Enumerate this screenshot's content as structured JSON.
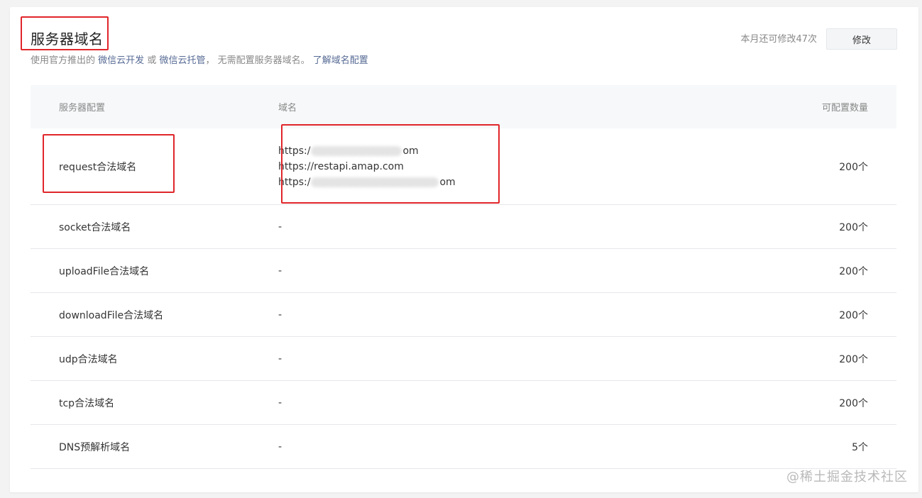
{
  "page": {
    "title": "服务器域名",
    "subtitle_prefix": "使用官方推出的",
    "link_cloud_dev": "微信云开发",
    "subtitle_or": "或",
    "link_cloud_host": "微信云托管",
    "subtitle_mid": "，  无需配置服务器域名。",
    "link_learn": "了解域名配置",
    "quota_text": "本月还可修改47次",
    "modify_label": "修改",
    "watermark": "@稀土掘金技术社区"
  },
  "table": {
    "headers": [
      "服务器配置",
      "域名",
      "可配置数量"
    ],
    "rows": [
      {
        "name": "request合法域名",
        "domains": [
          "https:/",
          "https://restapi.amap.com",
          "https:/"
        ],
        "domain_tails": [
          "om",
          "",
          "om"
        ],
        "count": "200个"
      },
      {
        "name": "socket合法域名",
        "domain": "-",
        "count": "200个"
      },
      {
        "name": "uploadFile合法域名",
        "domain": "-",
        "count": "200个"
      },
      {
        "name": "downloadFile合法域名",
        "domain": "-",
        "count": "200个"
      },
      {
        "name": "udp合法域名",
        "domain": "-",
        "count": "200个"
      },
      {
        "name": "tcp合法域名",
        "domain": "-",
        "count": "200个"
      },
      {
        "name": "DNS预解析域名",
        "domain": "-",
        "count": "5个"
      }
    ]
  },
  "colors": {
    "link": "#576b95",
    "highlight": "#e0262b",
    "header_bg": "#f6f8f9"
  }
}
